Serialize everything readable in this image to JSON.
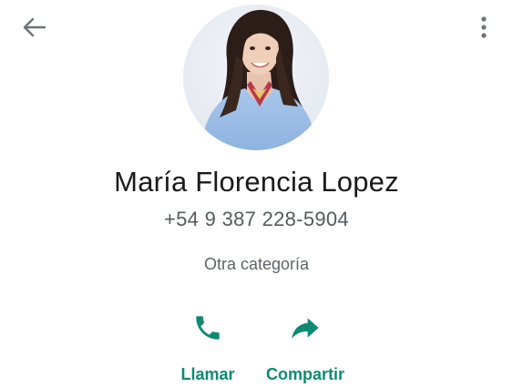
{
  "colors": {
    "accent": "#0e8a72",
    "icon_gray": "#6f7377",
    "name_text": "#1a1a1a",
    "secondary_text": "#555a5e"
  },
  "header": {
    "back_icon": "arrow-left-icon",
    "menu_icon": "more-vertical-icon"
  },
  "contact": {
    "name": "María Florencia Lopez",
    "phone": "+54 9 387 228-5904",
    "category": "Otra categoría"
  },
  "actions": [
    {
      "label": "Llamar",
      "icon": "phone-icon"
    },
    {
      "label": "Compartir",
      "icon": "share-arrow-icon"
    }
  ]
}
